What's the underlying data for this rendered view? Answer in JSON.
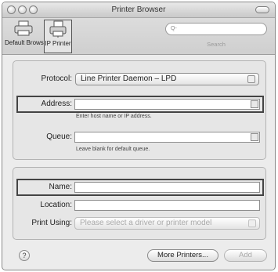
{
  "window": {
    "title": "Printer Browser"
  },
  "toolbar": {
    "default_browser_label": "Default Browser",
    "ip_printer_label": "IP Printer",
    "search_placeholder": "Q-",
    "search_label": "Search"
  },
  "ip_form": {
    "protocol_label": "Protocol:",
    "protocol_value": "Line Printer Daemon – LPD",
    "address_label": "Address:",
    "address_value": "",
    "address_hint": "Enter host name or IP address.",
    "queue_label": "Queue:",
    "queue_value": "",
    "queue_hint": "Leave blank for default queue."
  },
  "printer_info": {
    "name_label": "Name:",
    "name_value": "",
    "location_label": "Location:",
    "location_value": "",
    "print_using_label": "Print Using:",
    "print_using_value": "Please select a driver or printer model"
  },
  "footer": {
    "help_label": "?",
    "more_printers_label": "More Printers...",
    "add_label": "Add"
  }
}
